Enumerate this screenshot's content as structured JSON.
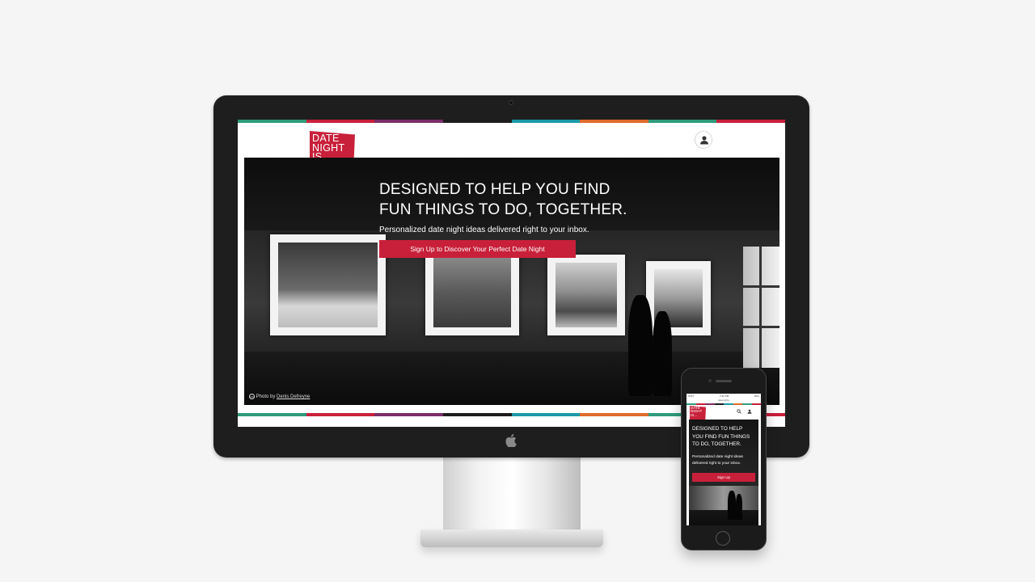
{
  "stripe_colors": [
    "#2e9b7c",
    "#c8203a",
    "#7a2d6a",
    "#1d1d1d",
    "#1a9aa6",
    "#e06b2a",
    "#2e9b7c",
    "#c8203a"
  ],
  "brand_color": "#c8203a",
  "desktop": {
    "logo_lines": [
      "DATE",
      "NIGHT",
      "IS..."
    ],
    "user_icon": "user-icon",
    "hero": {
      "heading_lines": [
        "DESIGNED TO HELP YOU FIND",
        "FUN THINGS TO DO, TOGETHER."
      ],
      "subheading": "Personalized date night ideas delivered right to your inbox.",
      "cta_label": "Sign Up to Discover Your Perfect Date Night",
      "credit_prefix": "Photo by",
      "credit_author": "Denis Defreyne",
      "credit_icon": "cc"
    }
  },
  "mobile": {
    "status": {
      "carrier": "AT&T",
      "time": "2:32 PM",
      "battery": "90%"
    },
    "url": "datenightis",
    "logo_lines": [
      "DATE",
      "NIGHT",
      "IS..."
    ],
    "heading_lines": [
      "DESIGNED TO HELP",
      "YOU FIND FUN THINGS",
      "TO DO, TOGETHER."
    ],
    "subheading_lines": [
      "Personalized date night ideas",
      "delivered right to your inbox."
    ],
    "cta_label": "Sign Up"
  }
}
